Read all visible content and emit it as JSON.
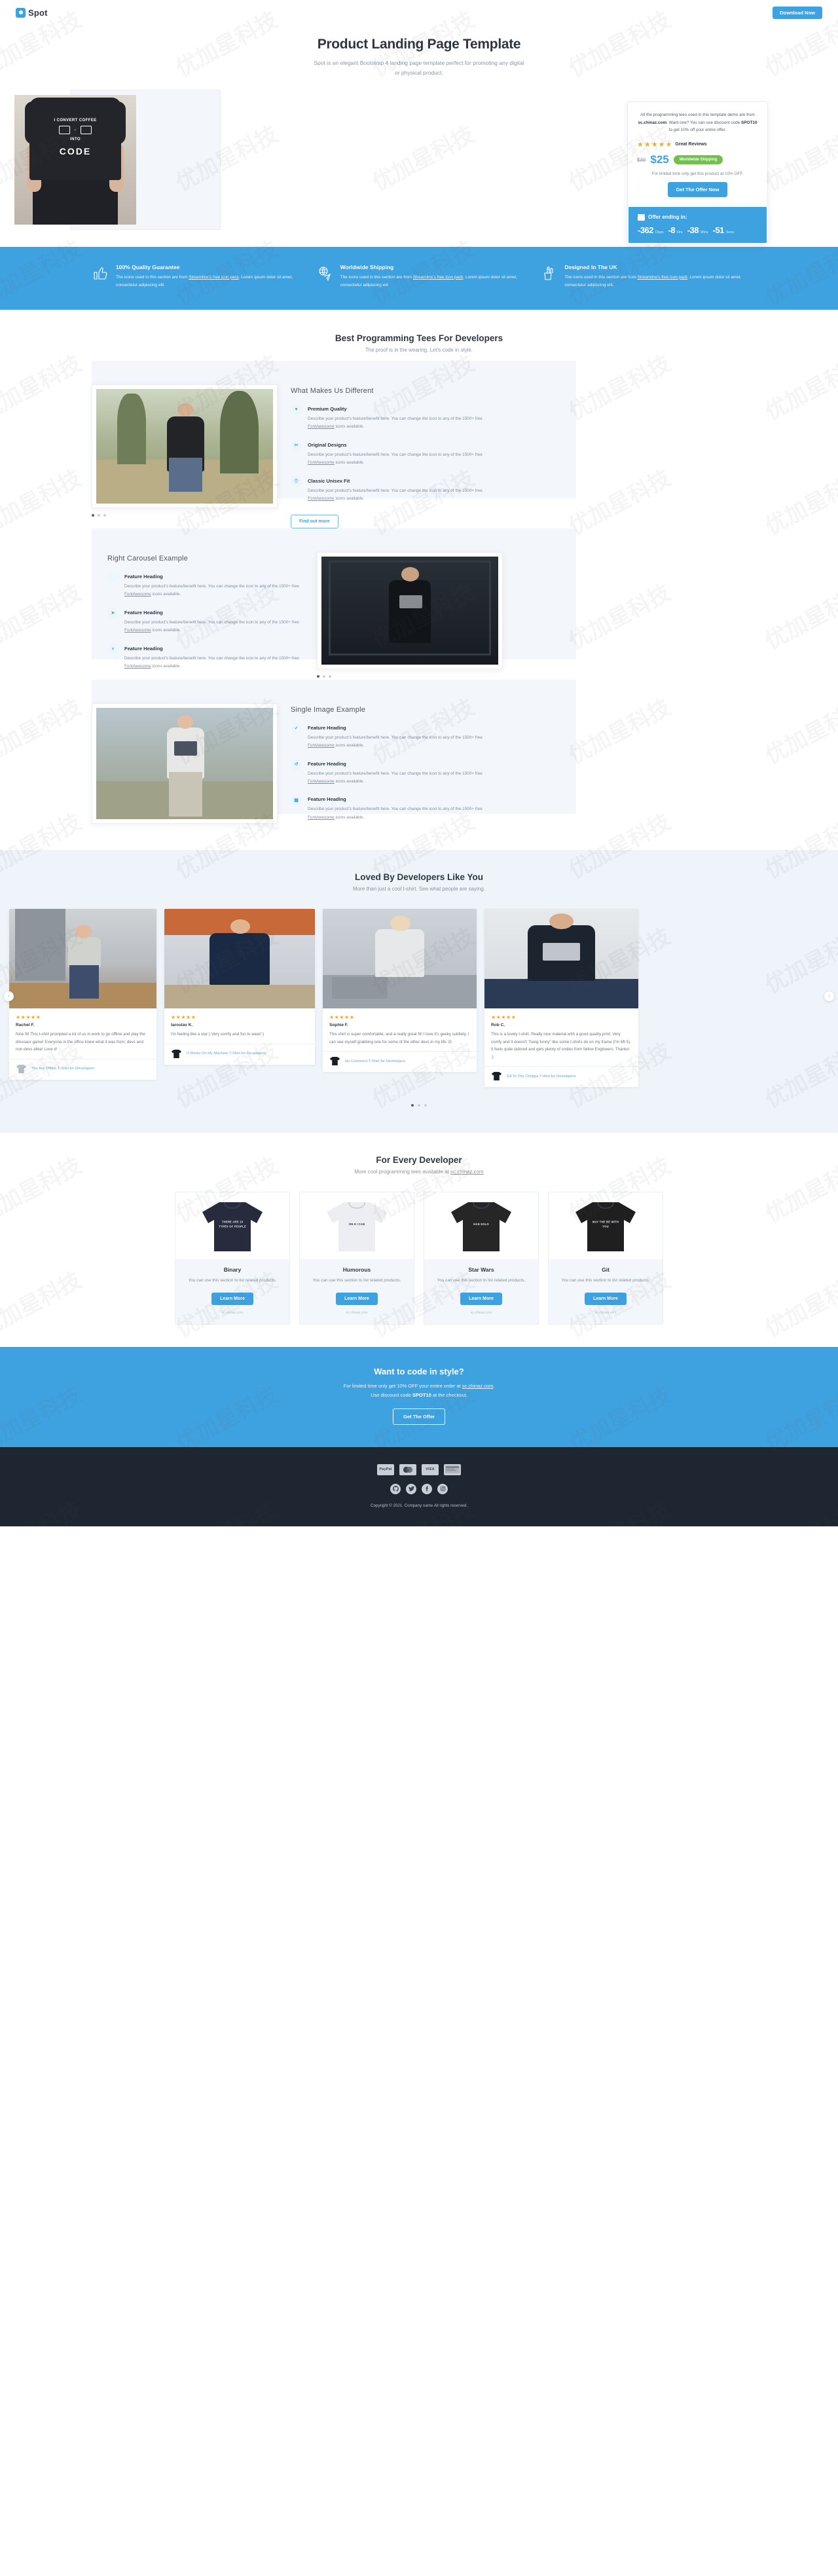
{
  "nav": {
    "brand": "Spot",
    "cta": "Download Now"
  },
  "hero": {
    "title": "Product Landing Page Template",
    "subtitle": "Spot is an elegant Bootstrap 4 landing page template perfect for promoting any digital or physical product.",
    "shirt": {
      "line1": "I CONVERT COFFEE",
      "line2": "INTO",
      "line3": "CODE"
    },
    "offer": {
      "note_1": "All the programming tees used in this template demo are from ",
      "note_site": "sc.chinaz.com",
      "note_2": ". Want one? You can use discount code ",
      "note_code": "SPOT10",
      "note_3": " to get 10% off your entire offer.",
      "stars": "★★★★★",
      "reviews_label": "Great Reviews",
      "price_old": "$30",
      "price_new": "$25",
      "shipping_badge": "Worldwide Shipping",
      "limited": "For limited time only get this product at 10% OFF.",
      "button": "Get The Offer Now"
    },
    "countdown": {
      "title": "Offer ending in:",
      "days_value": "-362",
      "days_unit": "Days",
      "hrs_value": "-8",
      "hrs_unit": "Hrs",
      "mins_value": "-38",
      "mins_unit": "Mins",
      "secs_value": "-51",
      "secs_unit": "Secs"
    }
  },
  "band": {
    "items": [
      {
        "icon": "thumbs-up-icon",
        "title": "100% Quality Guarantee",
        "text_1": "The icons used in this section are from ",
        "link": "Streamline's free icon pack",
        "text_2": ". Lorem ipsum dolor sit amet, consectetur adipiscing elit."
      },
      {
        "icon": "worldwide-shipping-icon",
        "title": "Worldwide Shipping",
        "text_1": "The icons used in this section are from ",
        "link": "Streamline's free icon pack",
        "text_2": ". Lorem ipsum dolor sit amet, consectetur adipiscing elit."
      },
      {
        "icon": "pencil-cup-icon",
        "title": "Designed In The UK",
        "text_1": "The icons used in this section are from ",
        "link": "Streamline's free icon pack",
        "text_2": ". Lorem ipsum dolor sit amet, consectetur adipiscing elit."
      }
    ]
  },
  "features_section": {
    "title": "Best Programming Tees For Developers",
    "subtitle": "The proof is in the wearing. Let's code in style.",
    "blocks": [
      {
        "layout": "left-carousel",
        "title": "What Makes Us Different",
        "items": [
          {
            "icon": "heart-icon",
            "glyph": "♥",
            "heading": "Premium Quality",
            "text_1": "Describe your product's feature/benefit here. You can change the icon to any of the 1500+ free ",
            "link": "FontAwesome",
            "text_2": " icons available."
          },
          {
            "icon": "scissors-icon",
            "glyph": "✂",
            "heading": "Original Designs",
            "text_1": "Describe your product's feature/benefit here. You can change the icon to any of the 1500+ free ",
            "link": "FontAwesome",
            "text_2": " icons available."
          },
          {
            "icon": "tshirt-icon",
            "glyph": "👕",
            "heading": "Classic Unisex Fit",
            "text_1": "Describe your product's feature/benefit here. You can change the icon to any of the 1500+ free ",
            "link": "FontAwesome",
            "text_2": " icons available."
          }
        ],
        "button": "Find out more"
      },
      {
        "layout": "right-carousel",
        "title": "Right Carousel Example",
        "items": [
          {
            "icon": "code-icon",
            "glyph": "</>",
            "heading": "Feature Heading",
            "text_1": "Describe your product's feature/benefit here. You can change the icon to any of the 1500+ free ",
            "link": "FontAwesome",
            "text_2": " icons available."
          },
          {
            "icon": "rocket-icon",
            "glyph": "➤",
            "heading": "Feature Heading",
            "text_1": "Describe your product's feature/benefit here. You can change the icon to any of the 1500+ free ",
            "link": "FontAwesome",
            "text_2": " icons available."
          },
          {
            "icon": "branch-icon",
            "glyph": "⑂",
            "heading": "Feature Heading",
            "text_1": "Describe your product's feature/benefit here. You can change the icon to any of the 1500+ free ",
            "link": "FontAwesome",
            "text_2": " icons available."
          }
        ],
        "button": ""
      },
      {
        "layout": "single-image",
        "title": "Single Image Example",
        "items": [
          {
            "icon": "check-icon",
            "glyph": "✓",
            "heading": "Feature Heading",
            "text_1": "Describe your product's feature/benefit here. You can change the icon to any of the 1500+ free ",
            "link": "FontAwesome",
            "text_2": " icons available."
          },
          {
            "icon": "history-icon",
            "glyph": "↺",
            "heading": "Feature Heading",
            "text_1": "Describe your product's feature/benefit here. You can change the icon to any of the 1500+ free ",
            "link": "FontAwesome",
            "text_2": " icons available."
          },
          {
            "icon": "calendar-icon",
            "glyph": "▦",
            "heading": "Feature Heading",
            "text_1": "Describe your product's feature/benefit here. You can change the icon to any of the 1500+ free ",
            "link": "FontAwesome",
            "text_2": " icons available."
          }
        ],
        "button": ""
      }
    ]
  },
  "testimonials": {
    "title": "Loved By Developers Like You",
    "subtitle": "More than just a cool t-shirt. See what people are saying.",
    "prev_label": "‹",
    "next_label": "›",
    "cards": [
      {
        "stars": "★★★★★",
        "name": "Rachel F.",
        "text": "Nice fit! This t-shirt prompted a lot of us in work to go offline and play the dinosaur game! Everyone in the office knew what it was from; devs and non-devs alike! Love it!",
        "product": "You Are Offline T-Shirt for Developers"
      },
      {
        "stars": "★★★★★",
        "name": "Iaroslav K.",
        "text": "I'm feeling like a star:) Very comfy and fun to wear!:)",
        "product": "It Works On My Machine T-Shirt for Developers"
      },
      {
        "stars": "★★★★★",
        "name": "Sophie F.",
        "text": "This shirt is super comfortable, and a really great fit! I love it's geeky subtlety, I can see myself grabbing one for some of the other devs in my life :D",
        "product": "No Comment T-Shirt for Developers"
      },
      {
        "stars": "★★★★★",
        "name": "Rob C.",
        "text": "This is a lovely t-shirt. Really nice material with a good quality print. Very comfy and it doesn't \"hang funny\" like some t-shirts do on my frame (I'm 6ft 5). It feels quite tailored and gets plenty of smiles from fellow Engineers. Thanks! :)",
        "product": "Git To The Choppa T-shirt for Developers"
      }
    ]
  },
  "products": {
    "title": "For Every Developer",
    "subtitle_1": "More cool programming tees available at ",
    "subtitle_link": "sc.chinaz.com",
    "items": [
      {
        "name": "Binary",
        "desc": "You can use this section to list related products.",
        "button": "Learn More",
        "source": "sc.chinaz.com",
        "shirt_color": "#272b3d",
        "print": "THERE ARE 10 TYPES OF PEOPLE"
      },
      {
        "name": "Humorous",
        "desc": "You can use this section to list related products.",
        "button": "Learn More",
        "source": "sc.chinaz.com",
        "shirt_color": "#eceef1",
        "print": "ON 8 I CAN"
      },
      {
        "name": "Star Wars",
        "desc": "You can use this section to list related products.",
        "button": "Learn More",
        "source": "sc.chinaz.com",
        "shirt_color": "#262626",
        "print": "HAN SOLO"
      },
      {
        "name": "Git",
        "desc": "You can use this section to list related products.",
        "button": "Learn More",
        "source": "sc.chinaz.com",
        "shirt_color": "#1f1f1f",
        "print": "MAY THE BE WITH YOU"
      }
    ]
  },
  "cta": {
    "title": "Want to code in style?",
    "line1_a": "For limited time only get 10% OFF your entire order at ",
    "line1_link": "sc.chinaz.com",
    "line1_b": ".",
    "line2_a": "Use discount code ",
    "line2_code": "SPOT10",
    "line2_b": " at the checkout.",
    "button": "Get The Offer"
  },
  "footer": {
    "payments": [
      "PayPal",
      "mastercard",
      "VISA",
      "amex"
    ],
    "socials": [
      "github-icon",
      "twitter-icon",
      "facebook-icon",
      "instagram-icon"
    ],
    "copyright": "Copyright © 2021. Company name All rights reserved."
  },
  "colors": {
    "accent": "#3fa2e0",
    "green": "#71c14b",
    "star": "#f5b428",
    "dark": "#1d2631",
    "tint": "#f3f7fb"
  }
}
